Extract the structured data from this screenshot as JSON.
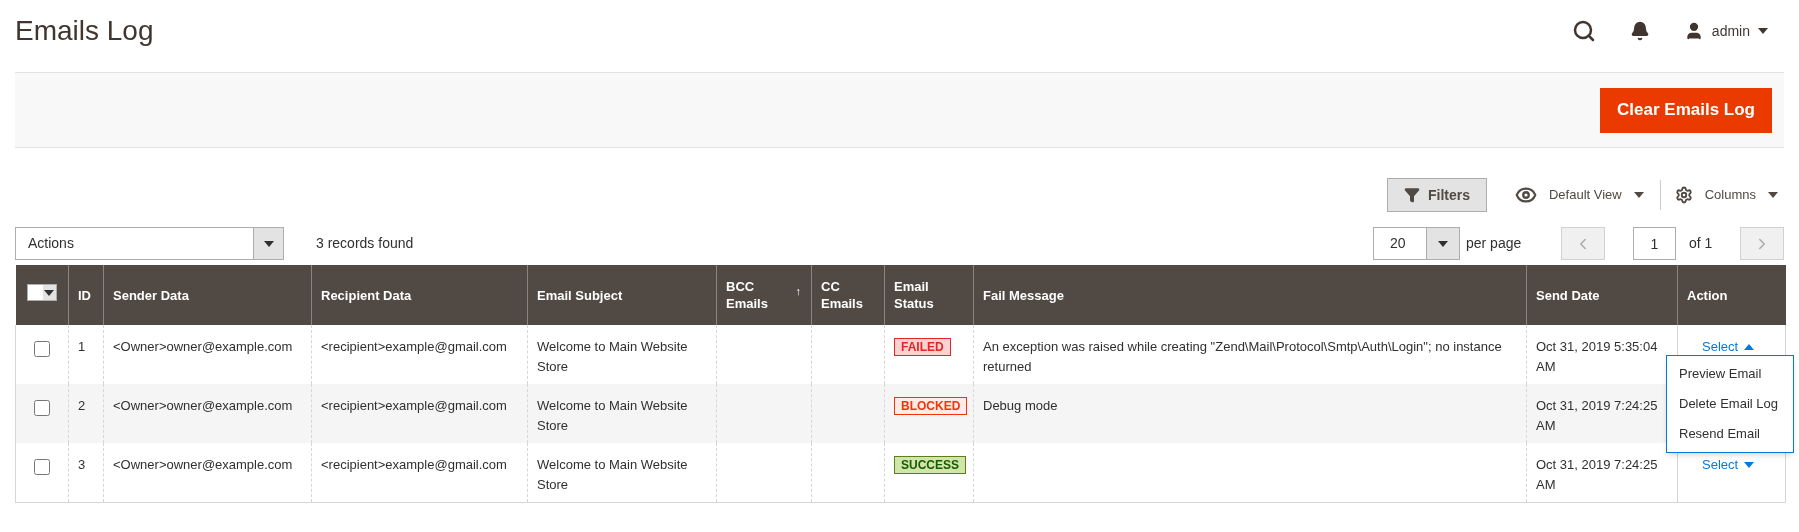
{
  "title": "Emails Log",
  "user": {
    "name": "admin"
  },
  "primary_button": "Clear Emails Log",
  "toolbar": {
    "filters": "Filters",
    "view": "Default View",
    "columns": "Columns"
  },
  "actions_select": {
    "value": "Actions"
  },
  "records": "3 records found",
  "mass_select": {
    "checked": false
  },
  "pager": {
    "per_page_value": "20",
    "per_page_label": "per page",
    "page": "1",
    "of": "of 1"
  },
  "table": {
    "columns": [
      {
        "label": "ID"
      },
      {
        "label": "Sender Data"
      },
      {
        "label": "Recipient Data"
      },
      {
        "label": "Email Subject"
      },
      {
        "label": "BCC Emails",
        "sort_mark": "↑"
      },
      {
        "label": "CC Emails"
      },
      {
        "label": "Email Status"
      },
      {
        "label": "Fail Message"
      },
      {
        "label": "Send Date"
      },
      {
        "label": "Action"
      }
    ],
    "rows": [
      {
        "checked": false,
        "id": "1",
        "sender": "<Owner>owner@example.com",
        "recipient": "<recipient>example@gmail.com",
        "subject": "Welcome to Main Website Store",
        "status": {
          "label": "FAILED",
          "kind": "failed"
        },
        "fail_message": "An exception was raised while creating \"Zend\\Mail\\Protocol\\Smtp\\Auth\\Login\"; no instance returned",
        "send_date": "Oct 31, 2019 5:35:04 AM",
        "action": {
          "label": "Select",
          "expanded": true,
          "menu": [
            "Preview Email",
            "Delete Email Log",
            "Resend Email"
          ]
        }
      },
      {
        "checked": false,
        "id": "2",
        "sender": "<Owner>owner@example.com",
        "recipient": "<recipient>example@gmail.com",
        "subject": "Welcome to Main Website Store",
        "status": {
          "label": "BLOCKED",
          "kind": "blocked"
        },
        "fail_message": "Debug mode",
        "send_date": "Oct 31, 2019 7:24:25 AM"
      },
      {
        "checked": false,
        "id": "3",
        "sender": "<Owner>owner@example.com",
        "recipient": "<recipient>example@gmail.com",
        "subject": "Welcome to Main Website Store",
        "status": {
          "label": "SUCCESS",
          "kind": "success"
        },
        "send_date": "Oct 31, 2019 7:24:25 AM",
        "action": {
          "label": "Select",
          "expanded": false
        }
      }
    ]
  }
}
